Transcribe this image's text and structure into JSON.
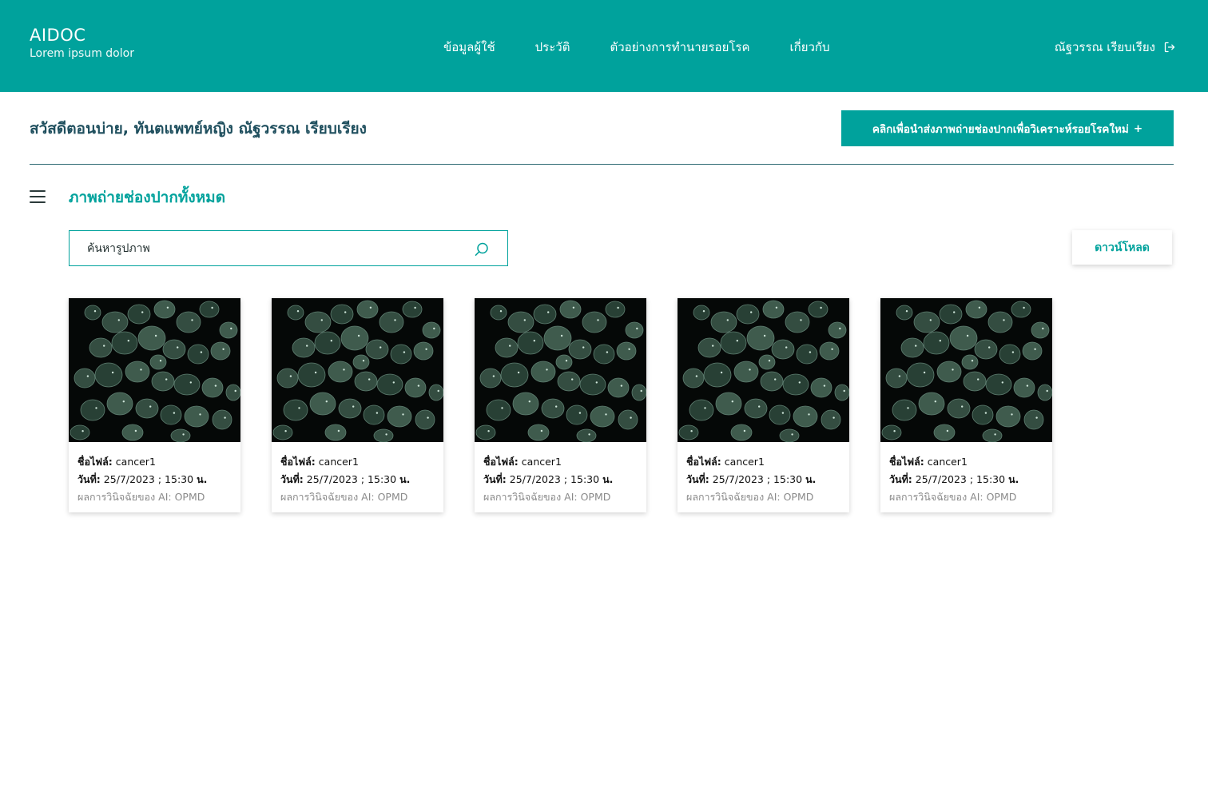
{
  "header": {
    "brand_title": "AIDOC",
    "brand_subtitle": "Lorem ipsum dolor",
    "nav": [
      "ข้อมูลผู้ใช้",
      "ประวัติ",
      "ตัวอย่างการทำนายรอยโรค",
      "เกี่ยวกับ"
    ],
    "user_name": "ณัฐวรรณ เรียบเรียง",
    "logout_icon": "logout-icon"
  },
  "main": {
    "greeting": "สวัสดีตอนบ่าย, ทันตแพทย์หญิง ณัฐวรรณ เรียบเรียง",
    "upload_label": "คลิกเพื่อนำส่งภาพถ่ายช่องปากเพื่อวิเคราะห์รอยโรคใหม่",
    "upload_plus": "+",
    "section_title": "ภาพถ่ายช่องปากทั้งหมด",
    "search_placeholder": "ค้นหารูปภาพ",
    "download_label": "ดาวน์โหลด"
  },
  "cards": [
    {
      "filename_label": "ชื่อไฟล์:",
      "filename": "cancer1",
      "date_label": "วันที่:",
      "date": "25/7/2023 ; 15:30",
      "date_unit": "น.",
      "result_label": "ผลการวินิจฉัยของ AI:",
      "result": "OPMD"
    },
    {
      "filename_label": "ชื่อไฟล์:",
      "filename": "cancer1",
      "date_label": "วันที่:",
      "date": "25/7/2023 ; 15:30",
      "date_unit": "น.",
      "result_label": "ผลการวินิจฉัยของ AI:",
      "result": "OPMD"
    },
    {
      "filename_label": "ชื่อไฟล์:",
      "filename": "cancer1",
      "date_label": "วันที่:",
      "date": "25/7/2023 ; 15:30",
      "date_unit": "น.",
      "result_label": "ผลการวินิจฉัยของ AI:",
      "result": "OPMD"
    },
    {
      "filename_label": "ชื่อไฟล์:",
      "filename": "cancer1",
      "date_label": "วันที่:",
      "date": "25/7/2023 ; 15:30",
      "date_unit": "น.",
      "result_label": "ผลการวินิจฉัยของ AI:",
      "result": "OPMD"
    },
    {
      "filename_label": "ชื่อไฟล์:",
      "filename": "cancer1",
      "date_label": "วันที่:",
      "date": "25/7/2023 ; 15:30",
      "date_unit": "น.",
      "result_label": "ผลการวินิจฉัยของ AI:",
      "result": "OPMD"
    }
  ],
  "colors": {
    "brand": "#00a29c",
    "heading": "#1f4f5e",
    "muted": "#8a8a8a"
  }
}
